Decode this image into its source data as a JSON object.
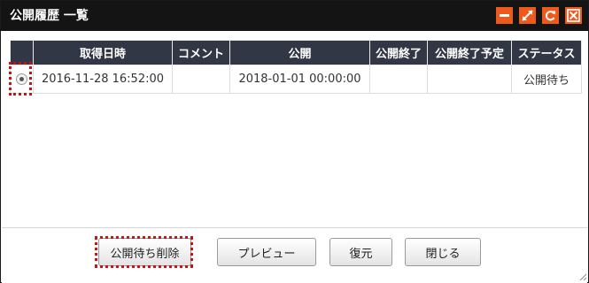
{
  "window": {
    "title": "公開履歴 一覧",
    "controls": [
      "minimize-icon",
      "maximize-icon",
      "refresh-icon",
      "close-icon"
    ],
    "accent": "#ef5a1c"
  },
  "table": {
    "columns": [
      "",
      "取得日時",
      "コメント",
      "公開",
      "公開終了",
      "公開終了予定",
      "ステータス"
    ],
    "rows": [
      {
        "selected": true,
        "acquired": "2016-11-28 16:52:00",
        "comment": "",
        "publish": "2018-01-01 00:00:00",
        "publish_end": "",
        "publish_end_scheduled": "",
        "status": "公開待ち"
      }
    ]
  },
  "buttons": {
    "delete_pending": "公開待ち削除",
    "preview": "プレビュー",
    "restore": "復元",
    "close": "閉じる"
  }
}
